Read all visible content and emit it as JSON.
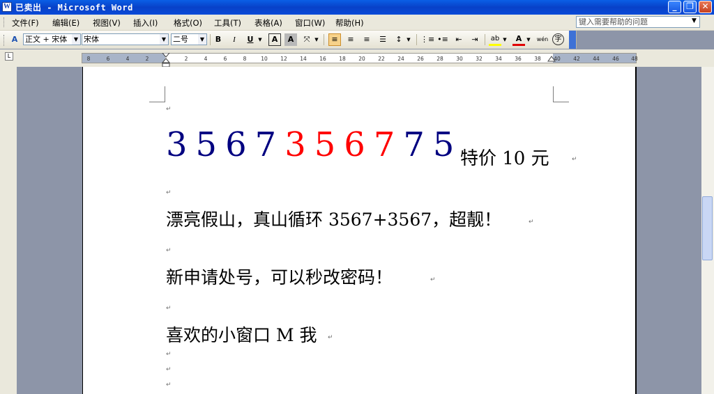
{
  "window": {
    "title": "已卖出 - Microsoft Word",
    "app_icon": "W"
  },
  "menu": [
    "文件(F)",
    "编辑(E)",
    "视图(V)",
    "插入(I)",
    "格式(O)",
    "工具(T)",
    "表格(A)",
    "窗口(W)",
    "帮助(H)"
  ],
  "help_box": {
    "placeholder": "键入需要帮助的问题"
  },
  "toolbar": {
    "style": "正文 + 宋体",
    "font": "宋体",
    "size": "二号",
    "bold": "B",
    "italic": "I",
    "underline": "U",
    "char_border": "A",
    "char_shading": "A",
    "highlight": "ab",
    "font_color": "A",
    "phonetic": "wén",
    "enclose": "字"
  },
  "ruler": {
    "ticks": [
      "8",
      "6",
      "4",
      "2",
      "2",
      "4",
      "6",
      "8",
      "10",
      "12",
      "14",
      "16",
      "18",
      "20",
      "22",
      "24",
      "26",
      "28",
      "30",
      "32",
      "34",
      "36",
      "38",
      "40",
      "42",
      "44",
      "46",
      "48"
    ]
  },
  "document": {
    "price_digits": [
      {
        "ch": "3",
        "color": "#000080"
      },
      {
        "ch": "5",
        "color": "#000080"
      },
      {
        "ch": "6",
        "color": "#000080"
      },
      {
        "ch": "7",
        "color": "#000080"
      },
      {
        "ch": "3",
        "color": "#ff0000"
      },
      {
        "ch": "5",
        "color": "#ff0000"
      },
      {
        "ch": "6",
        "color": "#ff0000"
      },
      {
        "ch": "7",
        "color": "#ff0000"
      },
      {
        "ch": "7",
        "color": "#000080"
      },
      {
        "ch": "5",
        "color": "#000080"
      }
    ],
    "price_suffix": "特价 10 元",
    "line1": "漂亮假山，真山循环 3567+3567，超靓！",
    "line2": "新申请处号，可以秒改密码！",
    "line3": "喜欢的小窗口 M 我",
    "para_mark": "↵"
  },
  "colors": {
    "titlebar": "#0841c8",
    "navy": "#000080",
    "red": "#ff0000"
  }
}
